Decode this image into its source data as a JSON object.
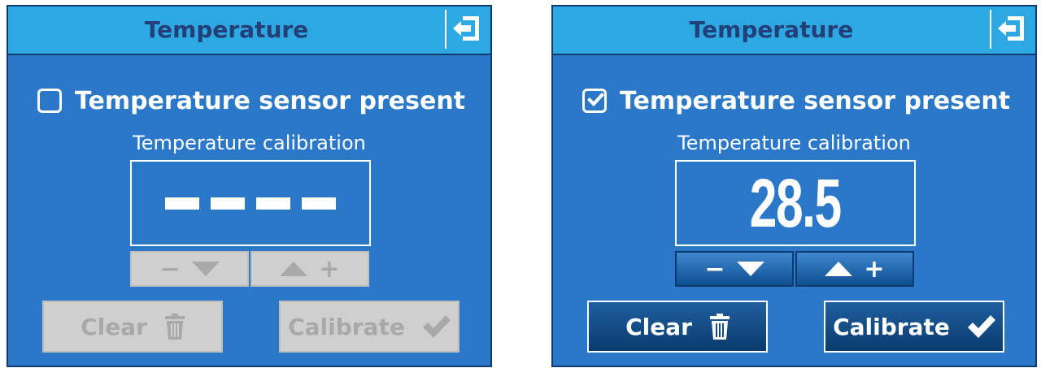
{
  "panels": [
    {
      "state": "disabled",
      "title": "Temperature",
      "sensor_present": false,
      "sensor_label": "Temperature sensor present",
      "calibration_label": "Temperature calibration",
      "calibration_value": null,
      "decrement_label": "−",
      "increment_label": "+",
      "clear_label": "Clear",
      "calibrate_label": "Calibrate"
    },
    {
      "state": "enabled",
      "title": "Temperature",
      "sensor_present": true,
      "sensor_label": "Temperature sensor present",
      "calibration_label": "Temperature calibration",
      "calibration_value": "28.5",
      "decrement_label": "−",
      "increment_label": "+",
      "clear_label": "Clear",
      "calibrate_label": "Calibrate"
    }
  ],
  "icons": {
    "exit": "exit-icon",
    "checkbox_checked": "checkmark-icon",
    "decrement": "triangle-down-icon",
    "increment": "triangle-up-icon",
    "clear": "trash-icon",
    "calibrate": "checkmark-icon"
  },
  "colors": {
    "panel_bg": "#2b78c8",
    "titlebar_bg": "#2ea8e2",
    "title_text": "#233f78",
    "disabled_button": "#cfcfcf",
    "enabled_button": "#0e4f90"
  }
}
